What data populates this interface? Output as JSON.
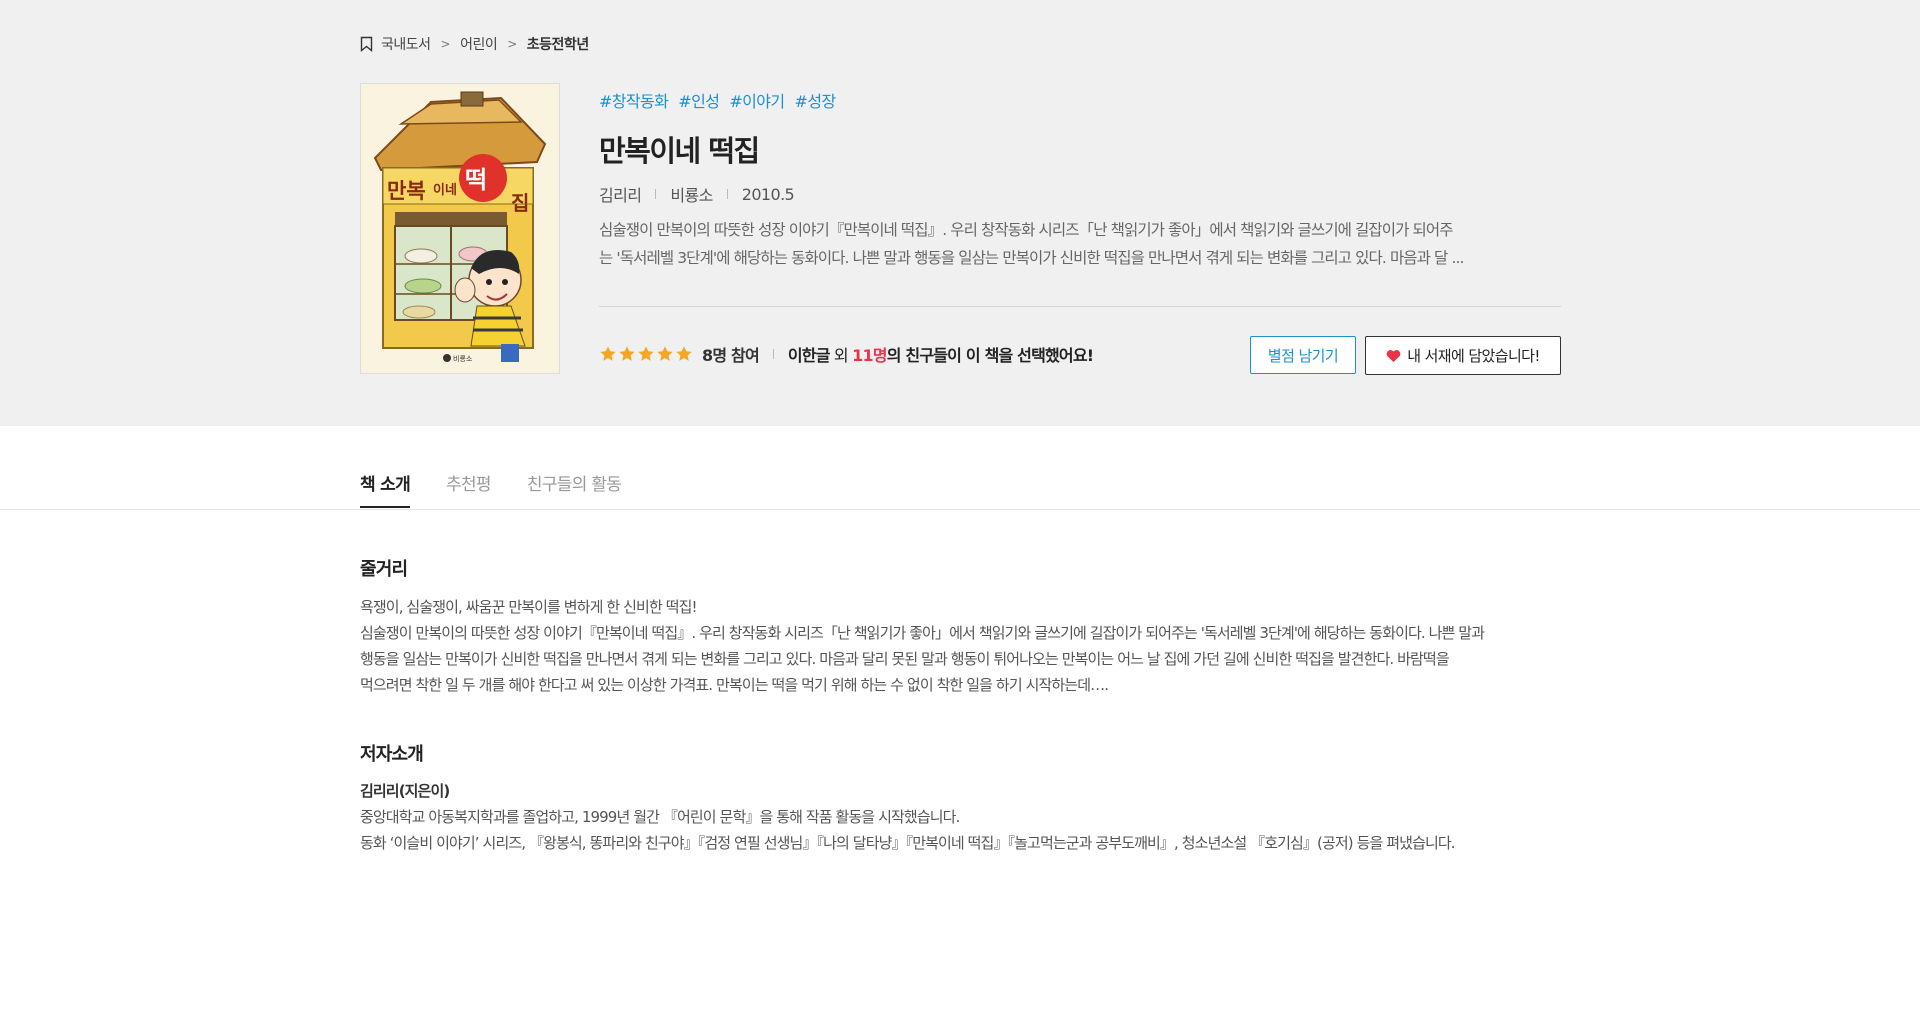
{
  "breadcrumb": {
    "items": [
      "국내도서",
      "어린이",
      "초등전학년"
    ],
    "separator": ">"
  },
  "book": {
    "tags": [
      "#창작동화",
      "#인성",
      "#이야기",
      "#성장"
    ],
    "title": "만복이네 떡집",
    "author": "김리리",
    "publisher": "비룡소",
    "date": "2010.5",
    "summary_line1": "심술쟁이 만복이의 따뜻한 성장 이야기『만복이네 떡집』. 우리 창작동화 시리즈「난 책읽기가 좋아」에서 책읽기와 글쓰기에 길잡이가 되어주",
    "summary_line2": "는 '독서레벨 3단계'에 해당하는 동화이다. 나쁜 말과 행동을 일삼는 만복이가 신비한 떡집을 만나면서 겪게 되는 변화를 그리고 있다. 마음과 달 ...",
    "cover": {
      "title_text": "만복이네 떡집",
      "publisher_mark": "비룡소"
    }
  },
  "rating": {
    "stars": 5,
    "participants": "8명 참여",
    "friend_name": "이한글",
    "friend_mid": " 외 ",
    "friend_count": "11명",
    "friend_suffix": "의 친구들이 이 책을 선택했어요!"
  },
  "buttons": {
    "rate": "별점 남기기",
    "shelf": "내 서재에 담았습니다!"
  },
  "tabs": [
    "책 소개",
    "추천평",
    "친구들의 활동"
  ],
  "synopsis": {
    "heading": "줄거리",
    "lines": [
      "욕쟁이, 심술쟁이, 싸움꾼 만복이를 변하게 한 신비한 떡집!",
      "심술쟁이 만복이의 따뜻한 성장 이야기『만복이네 떡집』. 우리 창작동화 시리즈「난 책읽기가 좋아」에서 책읽기와 글쓰기에 길잡이가 되어주는 '독서레벨 3단계'에 해당하는 동화이다. 나쁜 말과",
      "행동을 일삼는 만복이가 신비한 떡집을 만나면서 겪게 되는 변화를 그리고 있다. 마음과 달리 못된 말과 행동이 튀어나오는 만복이는 어느 날 집에 가던 길에 신비한 떡집을 발견한다. 바람떡을",
      "먹으려면 착한 일 두 개를 해야 한다고 써 있는 이상한 가격표. 만복이는 떡을 먹기 위해 하는 수 없이 착한 일을 하기 시작하는데…."
    ]
  },
  "author_section": {
    "heading": "저자소개",
    "name": "김리리(지은이)",
    "lines": [
      "중앙대학교 아동복지학과를 졸업하고, 1999년 월간 『어린이 문학』을 통해 작품 활동을 시작했습니다.",
      "동화 ‘이슬비 이야기’ 시리즈, 『왕봉식, 똥파리와 친구야』『검정 연필 선생님』『나의 달타냥』『만복이네 떡집』『놀고먹는군과 공부도깨비』, 청소년소설 『호기심』(공저) 등을 펴냈습니다."
    ]
  },
  "colors": {
    "accent_blue": "#1e8fd0",
    "highlight_red": "#e8334b",
    "star": "#f5a623",
    "heart": "#e8334b",
    "header_bg": "#f0f0f0"
  },
  "icons": {
    "breadcrumb": "bookmark-icon",
    "star": "star-icon",
    "heart": "heart-icon"
  }
}
